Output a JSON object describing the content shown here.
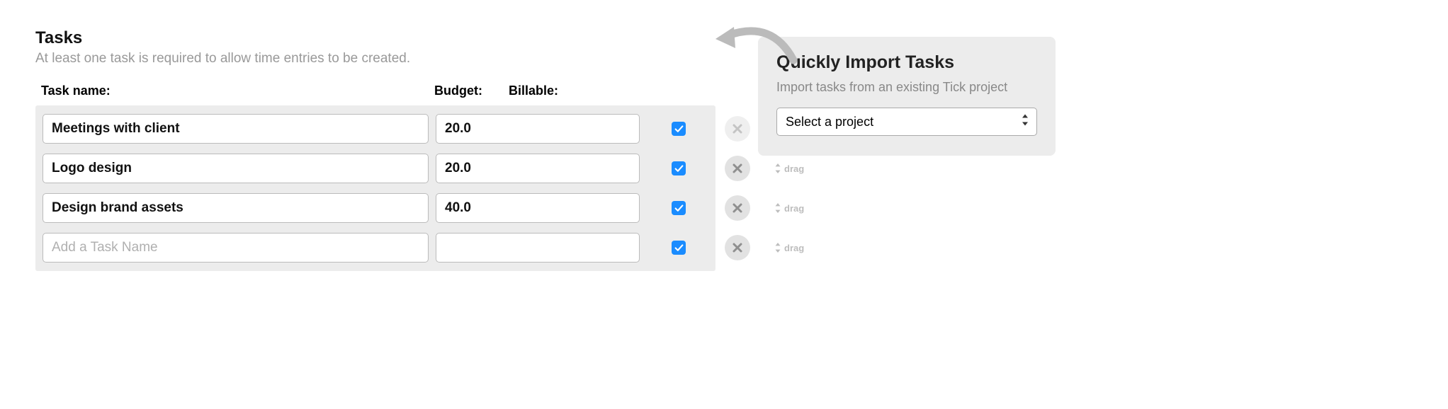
{
  "tasks_section": {
    "title": "Tasks",
    "subtitle": "At least one task is required to allow time entries to be created.",
    "columns": {
      "name": "Task name:",
      "budget": "Budget:",
      "billable": "Billable:"
    },
    "rows": [
      {
        "name": "Meetings with client",
        "budget": "20.0",
        "billable": true,
        "delete_dim": true
      },
      {
        "name": "Logo design",
        "budget": "20.0",
        "billable": true,
        "delete_dim": false
      },
      {
        "name": "Design brand assets",
        "budget": "40.0",
        "billable": true,
        "delete_dim": false
      },
      {
        "name": "",
        "budget": "",
        "billable": true,
        "delete_dim": false
      }
    ],
    "new_task_placeholder": "Add a Task Name",
    "drag_label": "drag"
  },
  "import_panel": {
    "title": "Quickly Import Tasks",
    "subtitle": "Import tasks from an existing Tick project",
    "select_placeholder": "Select a project"
  }
}
